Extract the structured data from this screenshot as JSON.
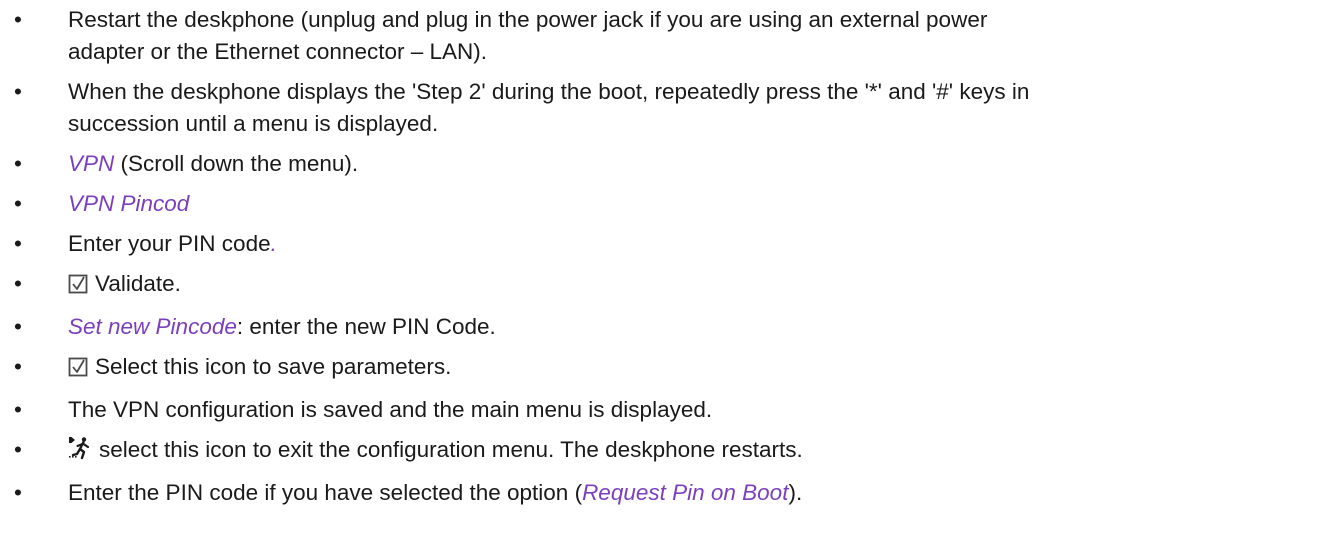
{
  "bullet": "•",
  "steps": [
    {
      "line1": "Restart the deskphone (unplug and plug in the power jack if you are using an external power",
      "line2": "adapter or the Ethernet connector – LAN)."
    },
    {
      "line1": "When the deskphone displays the 'Step 2' during the boot, repeatedly press the '*' and '#' keys in",
      "line2": "succession until a menu is displayed."
    },
    {
      "em": "VPN",
      "text": " (Scroll down the menu)."
    },
    {
      "em": "VPN Pincod"
    },
    {
      "text": "Enter your PIN code",
      "em": "."
    },
    {
      "icon": "checkbox-validate-icon",
      "text": "Validate."
    },
    {
      "em": "Set new Pincode",
      "text": ": enter the new PIN Code."
    },
    {
      "icon": "checkbox-validate-icon",
      "text": "Select this icon to save parameters."
    },
    {
      "text": "The VPN configuration is saved and the main menu is displayed."
    },
    {
      "icon": "exit-running-man-icon",
      "text": "select this icon to exit the configuration menu. The deskphone restarts."
    },
    {
      "pre": "Enter the PIN code if you have selected the option (",
      "em": "Request Pin on Boot",
      "post": ")."
    }
  ],
  "colors": {
    "text": "#1a1a1a",
    "emphasis": "#7a3fbf",
    "icon": "#4a4a4a"
  }
}
